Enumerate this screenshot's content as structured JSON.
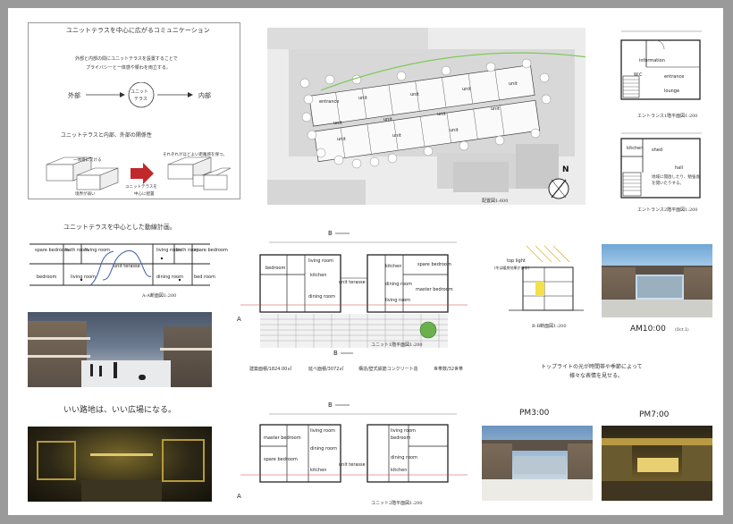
{
  "concept": {
    "title": "ユニットテラスを中心に広がるコミュニケーション",
    "intro_line1": "外部と内部の間にユニットテラスを設置することで",
    "intro_line2": "プライバシーと一体感や賑わを両立する。",
    "flow_left": "外部",
    "flow_center_1": "ユニット",
    "flow_center_2": "テラス",
    "flow_right": "内部",
    "relation_title": "ユニットテラスと内部、外部の関係性",
    "note_weak": "一体感に欠ける",
    "note_no_privacy": "境界が弱い",
    "arrow_caption_1": "ユニットテラスを",
    "arrow_caption_2": "中心に配置",
    "note_result": "それぞれがほどよい距離感を保つ。"
  },
  "site": {
    "caption": "配置図1:600",
    "north": "N",
    "labels": [
      "entrance",
      "unit",
      "unit",
      "unit",
      "unit",
      "unit",
      "unit",
      "unit",
      "unit",
      "unit",
      "unit",
      "unit"
    ]
  },
  "entrance1": {
    "caption": "エントランス1階平面図1:200",
    "rooms": [
      "information",
      "entrance",
      "lounge",
      "W.C"
    ]
  },
  "entrance2": {
    "caption": "エントランス2階平面図1:200",
    "rooms": [
      "kitchen",
      "shed",
      "hall"
    ],
    "note": "地域に開放したり、勉強会を開いたりする。"
  },
  "movement": {
    "title": "ユニットテラスを中心とした動線計画。",
    "section_caption": "A-A断面図1:200",
    "rooms": [
      "spare bedroom",
      "bath room",
      "living room",
      "unit terasse",
      "living room",
      "bath room",
      "spare bedroom",
      "bedroom",
      "living room",
      "dining room",
      "bed room"
    ]
  },
  "plan1": {
    "caption": "ユニット1階平面図1:200",
    "marker_b": "B",
    "marker_a": "A",
    "rooms": [
      "bedroom",
      "kitchen",
      "living room",
      "dining room",
      "unit terasse",
      "spare bedroom",
      "master bedroom",
      "dining room",
      "living room",
      "kitchen"
    ],
    "stats": [
      "建築面積/1824.00㎡",
      "延べ面積/3072㎡",
      "構造/壁式鉄筋コンクリート造",
      "世帯数/32世帯"
    ]
  },
  "plan2": {
    "caption": "ユニット2階平面図1:200",
    "rooms": [
      "master bedroom",
      "living room",
      "dining room",
      "spare bedroom",
      "kitchen",
      "unit terasse",
      "bedroom",
      "living room",
      "dining room",
      "kitchen"
    ]
  },
  "section_bb": {
    "caption": "B-B断面図1:200",
    "toplight": "top light",
    "toplight_note": "(冬は暖房効果がある)"
  },
  "renders": {
    "am": "AM10:00",
    "am_date": "(Oct.1)",
    "pm3": "PM3:00",
    "pm7": "PM7:00",
    "toplight_line1": "トップライトの光が時間帯や季節によって",
    "toplight_line2": "様々な表情を見せる。"
  },
  "alley": {
    "title": "いい路地は、いい広場になる。"
  }
}
